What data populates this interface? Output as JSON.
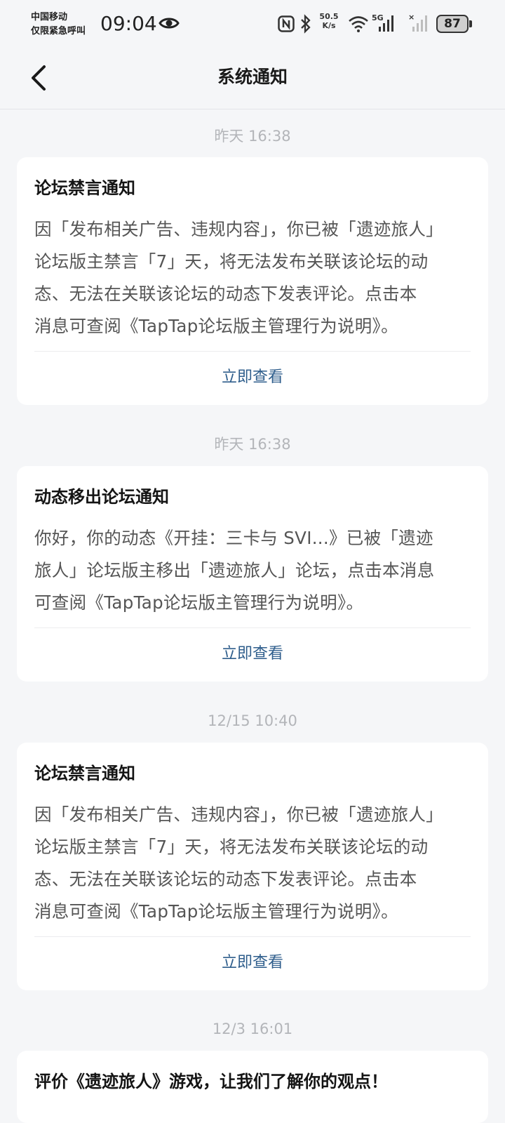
{
  "status_bar": {
    "carrier_line1": "中国移动",
    "carrier_line2": "仅限紧急呼叫",
    "time": "09:04",
    "net_speed_value": "50.5",
    "net_speed_unit": "K/s",
    "network_type": "5G",
    "battery": "87"
  },
  "header": {
    "title": "系统通知",
    "back_icon": "chevron-left-icon"
  },
  "notifications": [
    {
      "time": "昨天  16:38",
      "title": "论坛禁言通知",
      "lines": [
        "因「发布相关广告、违规内容」，你已被「遗迹旅人」",
        "论坛版主禁言「7」天，将无法发布关联该论坛的动",
        "态、无法在关联该论坛的动态下发表评论。点击本",
        "消息可查阅《TapTap论坛版主管理行为说明》。"
      ],
      "action": "立即查看"
    },
    {
      "time": "昨天  16:38",
      "title": "动态移出论坛通知",
      "lines": [
        "你好，你的动态《开挂：三卡与 SVI...》已被「遗迹",
        "旅人」论坛版主移出「遗迹旅人」论坛，点击本消息",
        "可查阅《TapTap论坛版主管理行为说明》。"
      ],
      "action": "立即查看"
    },
    {
      "time": "12/15  10:40",
      "title": "论坛禁言通知",
      "lines": [
        "因「发布相关广告、违规内容」，你已被「遗迹旅人」",
        "论坛版主禁言「7」天，将无法发布关联该论坛的动",
        "态、无法在关联该论坛的动态下发表评论。点击本",
        "消息可查阅《TapTap论坛版主管理行为说明》。"
      ],
      "action": "立即查看"
    },
    {
      "time": "12/3  16:01",
      "title": "评价《遗迹旅人》游戏，让我们了解你的观点！"
    }
  ],
  "colors": {
    "background": "#f5f6f8",
    "card": "#ffffff",
    "action_link": "#2f5e8c",
    "timestamp": "#b3b5b9"
  }
}
